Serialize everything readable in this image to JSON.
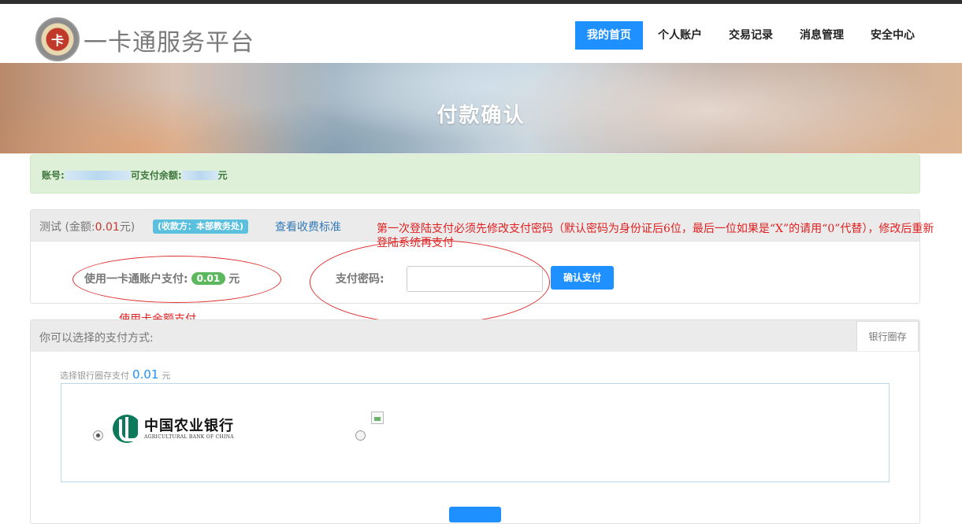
{
  "header": {
    "logo_text": "一卡通服务平台",
    "nav": [
      {
        "label": "我的首页",
        "active": true
      },
      {
        "label": "个人账户",
        "active": false
      },
      {
        "label": "交易记录",
        "active": false
      },
      {
        "label": "消息管理",
        "active": false
      },
      {
        "label": "安全中心",
        "active": false
      }
    ]
  },
  "banner": {
    "title": "付款确认"
  },
  "account_alert": {
    "account_label": "账号:",
    "balance_label": "可支付余额:",
    "currency": "元"
  },
  "payment_panel": {
    "item_name": "测试",
    "amount_prefix": " (金额:",
    "amount": "0.01",
    "amount_suffix": "元)",
    "payee_badge": "(收款方：本部教务处)",
    "fee_link": "查看收费标准",
    "card_pay_label": "使用一卡通账户支付:",
    "card_pay_amount": "0.01",
    "card_pay_currency": "元",
    "password_label": "支付密码:",
    "password_value": "",
    "confirm_button": "确认支付"
  },
  "annotations": {
    "note_password": "第一次登陆支付必须先修改支付密码（默认密码为身份证后6位，最后一位如果是“X”的请用“0”代替），修改后重新登陆系统再支付",
    "note_card": "使用卡余额支付",
    "color": "#e02020"
  },
  "methods_panel": {
    "title": "你可以选择的支付方式:",
    "tab_label": "银行圈存",
    "select_prefix": "选择银行圈存支付",
    "select_amount": "0.01",
    "select_currency": "元",
    "banks": [
      {
        "name_cn": "中国农业银行",
        "name_en": "AGRICULTURAL BANK OF CHINA",
        "selected": true
      },
      {
        "name_cn": "",
        "name_en": "",
        "selected": false
      }
    ]
  },
  "colors": {
    "primary": "#1e90ff",
    "success_bg": "#dff0d8",
    "badge_green": "#5cb85c",
    "info": "#5bc0de"
  }
}
